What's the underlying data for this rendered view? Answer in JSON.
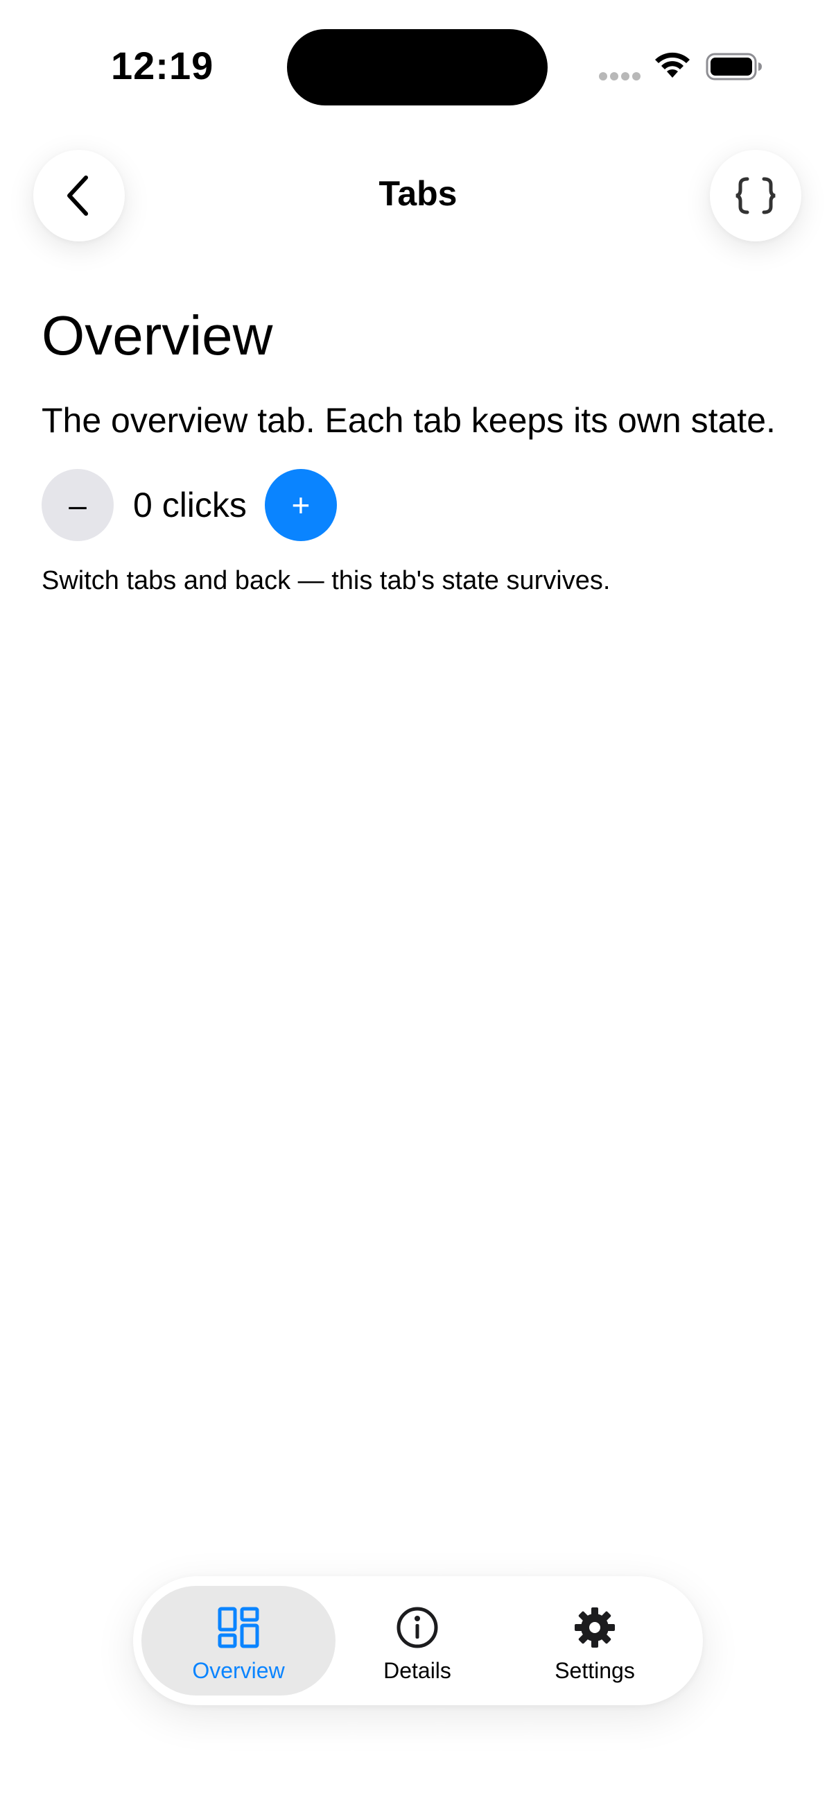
{
  "status_bar": {
    "time": "12:19",
    "icons": [
      "signal-dots-icon",
      "wifi-icon",
      "battery-icon"
    ]
  },
  "nav": {
    "title": "Tabs",
    "back_icon": "chevron-left-icon",
    "right_icon": "braces-icon"
  },
  "content": {
    "heading": "Overview",
    "description": "The overview tab. Each tab keeps its own state.",
    "counter": {
      "decrement_label": "–",
      "value_text": "0 clicks",
      "increment_label": "+"
    },
    "hint": "Switch tabs and back — this tab's state survives."
  },
  "tab_bar": {
    "tabs": [
      {
        "label": "Overview",
        "icon": "dashboard-icon",
        "active": true
      },
      {
        "label": "Details",
        "icon": "info-icon",
        "active": false
      },
      {
        "label": "Settings",
        "icon": "gear-icon",
        "active": false
      }
    ]
  },
  "colors": {
    "accent": "#0a84ff",
    "button_gray": "#e5e5ea",
    "active_tab_bg": "#e8e8e8"
  }
}
